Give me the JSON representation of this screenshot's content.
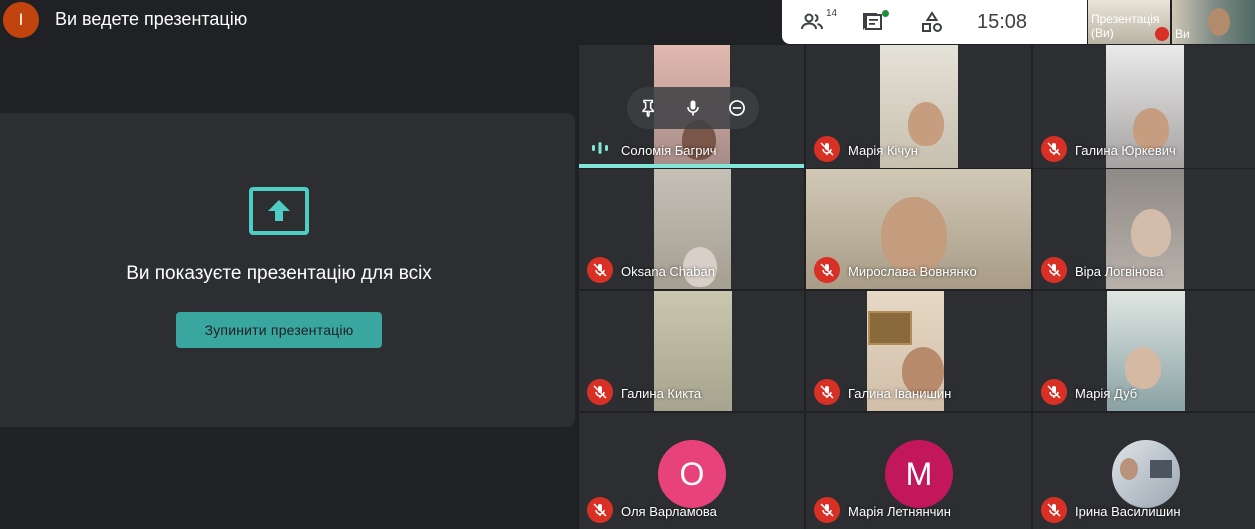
{
  "banner": {
    "avatar_letter": "I",
    "title": "Ви ведете презентацію"
  },
  "topbar": {
    "participants_count": "14",
    "time": "15:08"
  },
  "self_tiles": {
    "presentation_label": "Презентація (Ви)",
    "self_label": "Ви"
  },
  "presentation": {
    "message": "Ви показуєте презентацію для всіх",
    "stop_button": "Зупинити презентацію"
  },
  "participants": [
    {
      "name": "Соломія Багрич",
      "muted": false,
      "speaking": true
    },
    {
      "name": "Марія Кічун",
      "muted": true
    },
    {
      "name": "Галина Юркевич",
      "muted": true
    },
    {
      "name": "Oksana Chaban",
      "muted": true
    },
    {
      "name": "Мирослава Вовнянко",
      "muted": true
    },
    {
      "name": "Віра Логвінова",
      "muted": true
    },
    {
      "name": "Галина Кикта",
      "muted": true
    },
    {
      "name": "Галина Іванишин",
      "muted": true
    },
    {
      "name": "Марія Дуб",
      "muted": true
    },
    {
      "name": "Оля Варламова",
      "muted": true,
      "avatar_letter": "О",
      "avatar_color": "#e8427b"
    },
    {
      "name": "Марія Летнянчин",
      "muted": true,
      "avatar_letter": "М",
      "avatar_color": "#c2185b"
    },
    {
      "name": "Ірина Василишин",
      "muted": true
    }
  ]
}
